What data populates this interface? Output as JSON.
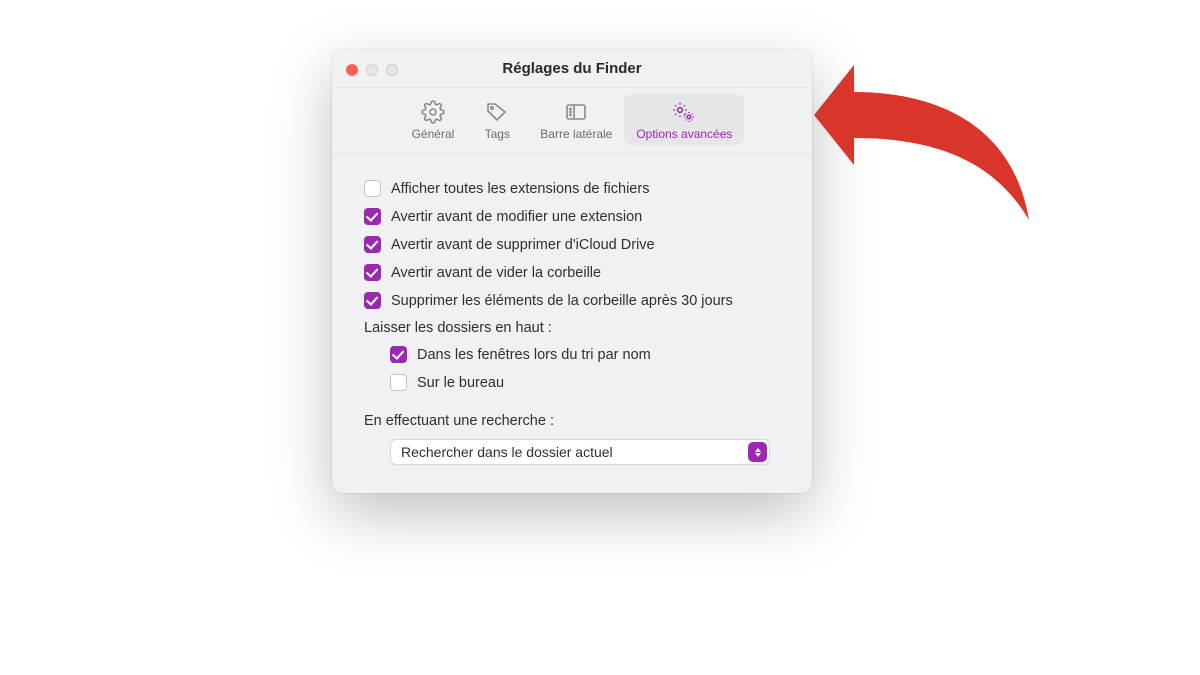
{
  "window": {
    "title": "Réglages du Finder"
  },
  "tabs": {
    "general": "Général",
    "tags": "Tags",
    "sidebar": "Barre latérale",
    "advanced": "Options avancées"
  },
  "options": {
    "show_all_extensions": {
      "label": "Afficher toutes les extensions de fichiers",
      "checked": false
    },
    "warn_change_ext": {
      "label": "Avertir avant de modifier une extension",
      "checked": true
    },
    "warn_remove_icloud": {
      "label": "Avertir avant de supprimer d'iCloud Drive",
      "checked": true
    },
    "warn_empty_trash": {
      "label": "Avertir avant de vider la corbeille",
      "checked": true
    },
    "remove_after_30": {
      "label": "Supprimer les éléments de la corbeille après 30 jours",
      "checked": true
    },
    "folders_top_section": "Laisser les dossiers en haut :",
    "folders_top_windows": {
      "label": "Dans les fenêtres lors du tri par nom",
      "checked": true
    },
    "folders_top_desktop": {
      "label": "Sur le bureau",
      "checked": false
    },
    "search_section": "En effectuant une recherche :",
    "search_scope": "Rechercher dans le dossier actuel"
  },
  "colors": {
    "accent": "#9c27b0",
    "annotation": "#d9362b"
  }
}
